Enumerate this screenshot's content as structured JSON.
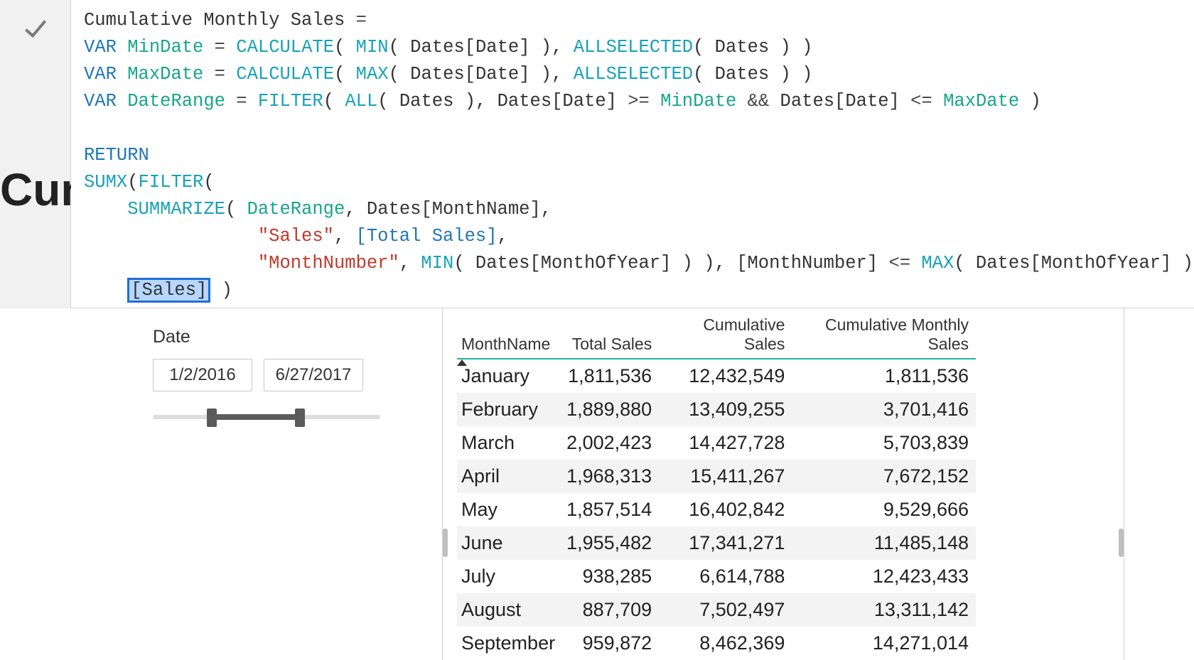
{
  "formula": {
    "line1": {
      "name": "Cumulative Monthly Sales",
      "eq": "="
    },
    "line2": {
      "var": "VAR",
      "name": "MinDate",
      "eq": "=",
      "calc": "CALCULATE",
      "min": "MIN",
      "col": "Dates[Date]",
      "allsel": "ALLSELECTED",
      "tbl": "Dates"
    },
    "line3": {
      "var": "VAR",
      "name": "MaxDate",
      "eq": "=",
      "calc": "CALCULATE",
      "max": "MAX",
      "col": "Dates[Date]",
      "allsel": "ALLSELECTED",
      "tbl": "Dates"
    },
    "line4": {
      "var": "VAR",
      "name": "DateRange",
      "eq": "=",
      "filter": "FILTER",
      "all": "ALL",
      "tbl": "Dates",
      "col": "Dates[Date]",
      "gte": ">=",
      "min": "MinDate",
      "and": "&&",
      "lte": "<=",
      "max": "MaxDate"
    },
    "line6": {
      "return": "RETURN"
    },
    "line7": {
      "sumx": "SUMX",
      "filter": "FILTER"
    },
    "line8": {
      "summarize": "SUMMARIZE",
      "dr": "DateRange",
      "mn": "Dates[MonthName]"
    },
    "line9": {
      "label": "\"Sales\"",
      "meas": "[Total Sales]"
    },
    "line10": {
      "label": "\"MonthNumber\"",
      "min": "MIN",
      "moy": "Dates[MonthOfYear]",
      "mnCol": "[MonthNumber]",
      "lte": "<=",
      "max": "MAX"
    },
    "line11": {
      "sales": "[Sales]"
    }
  },
  "cut_title": "Cum",
  "slicer": {
    "label": "Date",
    "from": "1/2/2016",
    "to": "6/27/2017"
  },
  "table": {
    "headers": [
      "MonthName",
      "Total Sales",
      "Cumulative Sales",
      "Cumulative Monthly Sales"
    ],
    "rows": [
      {
        "m": "January",
        "ts": "1,811,536",
        "cs": "12,432,549",
        "cms": "1,811,536"
      },
      {
        "m": "February",
        "ts": "1,889,880",
        "cs": "13,409,255",
        "cms": "3,701,416"
      },
      {
        "m": "March",
        "ts": "2,002,423",
        "cs": "14,427,728",
        "cms": "5,703,839"
      },
      {
        "m": "April",
        "ts": "1,968,313",
        "cs": "15,411,267",
        "cms": "7,672,152"
      },
      {
        "m": "May",
        "ts": "1,857,514",
        "cs": "16,402,842",
        "cms": "9,529,666"
      },
      {
        "m": "June",
        "ts": "1,955,482",
        "cs": "17,341,271",
        "cms": "11,485,148"
      },
      {
        "m": "July",
        "ts": "938,285",
        "cs": "6,614,788",
        "cms": "12,423,433"
      },
      {
        "m": "August",
        "ts": "887,709",
        "cs": "7,502,497",
        "cms": "13,311,142"
      },
      {
        "m": "September",
        "ts": "959,872",
        "cs": "8,462,369",
        "cms": "14,271,014"
      }
    ]
  }
}
